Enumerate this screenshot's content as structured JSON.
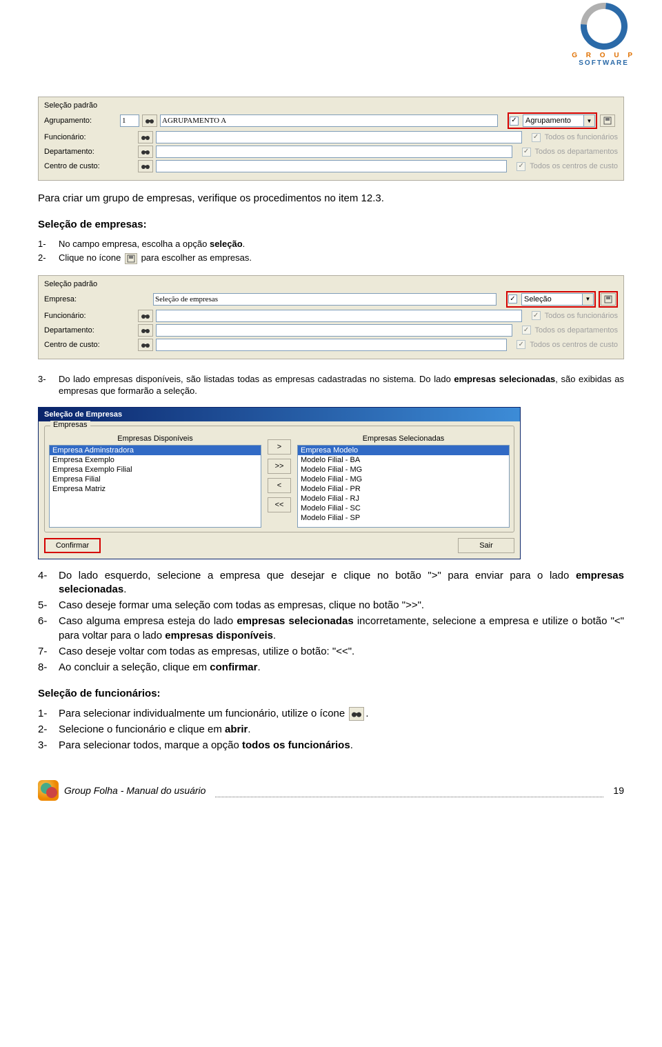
{
  "logo": {
    "line1": "G R O U P",
    "line2": "SOFTWARE"
  },
  "panel1": {
    "section": "Seleção padrão",
    "rows": {
      "agrupamento": {
        "label": "Agrupamento:",
        "num": "1",
        "text": "AGRUPAMENTO A",
        "check": true,
        "dropdown": "Agrupamento"
      },
      "funcionario": {
        "label": "Funcionário:",
        "check": true,
        "checklabel": "Todos os funcionários"
      },
      "departamento": {
        "label": "Departamento:",
        "check": true,
        "checklabel": "Todos os departamentos"
      },
      "centro": {
        "label": "Centro de custo:",
        "check": true,
        "checklabel": "Todos os centros de custo"
      }
    }
  },
  "text_after_panel1": "Para criar um grupo de empresas, verifique os procedimentos no item 12.3.",
  "heading_selecao_empresas": "Seleção de empresas:",
  "step1_1a": "No campo empresa, escolha a opção ",
  "step1_1b": "seleção",
  "step1_1c": ".",
  "step1_2a": "Clique no ícone ",
  "step1_2b": " para escolher as empresas.",
  "panel2": {
    "section": "Seleção padrão",
    "rows": {
      "empresa": {
        "label": "Empresa:",
        "text": "Seleção de empresas",
        "check": true,
        "dropdown": "Seleção"
      },
      "funcionario": {
        "label": "Funcionário:",
        "check": true,
        "checklabel": "Todos os funcionários"
      },
      "departamento": {
        "label": "Departamento:",
        "check": true,
        "checklabel": "Todos os departamentos"
      },
      "centro": {
        "label": "Centro de custo:",
        "check": true,
        "checklabel": "Todos os centros de custo"
      }
    }
  },
  "step3a": "Do lado empresas disponíveis, são listadas todas as empresas cadastradas no sistema. Do lado ",
  "step3b": "empresas selecionadas",
  "step3c": ", são exibidas as empresas que formarão a seleção.",
  "dialog": {
    "title": "Seleção de Empresas",
    "legend": "Empresas",
    "left_header": "Empresas Disponíveis",
    "right_header": "Empresas Selecionadas",
    "left_items": [
      "Empresa Adminstradora",
      "Empresa Exemplo",
      "Empresa Exemplo Filial",
      "Empresa Filial",
      "Empresa Matriz"
    ],
    "right_items": [
      "Empresa Modelo",
      "Modelo Filial - BA",
      "Modelo Filial - MG",
      "Modelo Filial - MG",
      "Modelo Filial - PR",
      "Modelo Filial - RJ",
      "Modelo Filial - SC",
      "Modelo Filial - SP"
    ],
    "move": {
      "r1": ">",
      "r2": ">>",
      "l1": "<",
      "l2": "<<"
    },
    "confirm": "Confirmar",
    "exit": "Sair"
  },
  "step4a": "Do lado esquerdo, selecione a empresa que desejar e clique no botão \">\" para enviar para o lado ",
  "step4b": "empresas selecionadas",
  "step4c": ".",
  "step5": "Caso deseje formar uma seleção com todas as empresas, clique no botão \">>\".",
  "step6a": "Caso alguma empresa esteja do lado ",
  "step6b": "empresas selecionadas",
  "step6c": " incorretamente, selecione a empresa e utilize o botão \"<\" para voltar para o lado ",
  "step6d": "empresas disponíveis",
  "step6e": ".",
  "step7": "Caso deseje voltar com todas as empresas, utilize o botão: \"<<\".",
  "step8a": "Ao concluir a seleção, clique em ",
  "step8b": "confirmar",
  "step8c": ".",
  "heading_selecao_func": "Seleção de funcionários:",
  "sf1a": "Para selecionar individualmente um funcionário, utilize o ícone ",
  "sf1b": ".",
  "sf2a": "Selecione o funcionário e clique em ",
  "sf2b": "abrir",
  "sf2c": ".",
  "sf3a": "Para selecionar todos, marque a opção ",
  "sf3b": "todos os funcionários",
  "sf3c": ".",
  "footer_text": "Group Folha - Manual do usuário",
  "page_number": "19",
  "nums": {
    "n1": "1-",
    "n2": "2-",
    "n3": "3-",
    "n4": "4-",
    "n5": "5-",
    "n6": "6-",
    "n7": "7-",
    "n8": "8-"
  }
}
